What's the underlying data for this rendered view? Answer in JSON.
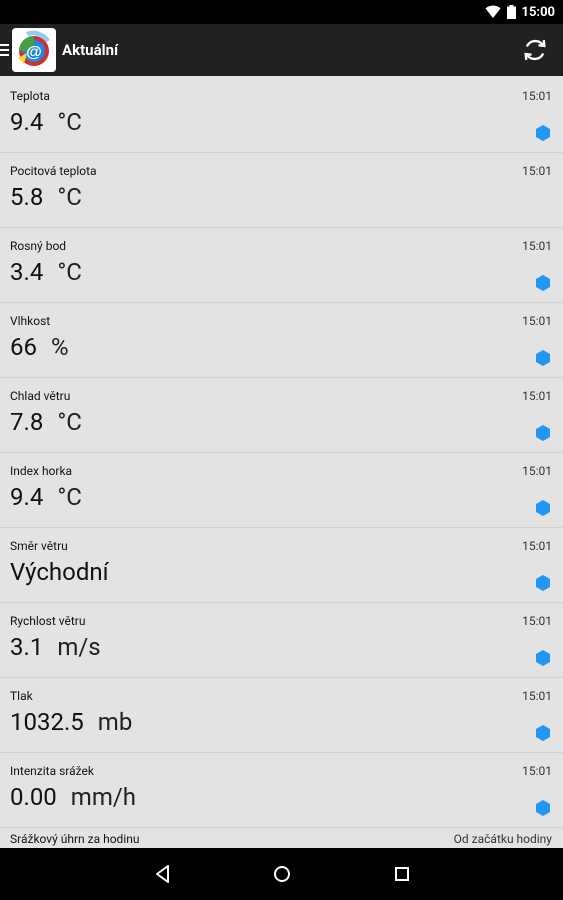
{
  "status_bar": {
    "time": "15:00"
  },
  "app_bar": {
    "title": "Aktuální",
    "app_icon_text": "@"
  },
  "rows": [
    {
      "label": "Teplota",
      "time": "15:01",
      "value": "9.4",
      "unit": "°C",
      "indicator": true
    },
    {
      "label": "Pocitová teplota",
      "time": "15:01",
      "value": "5.8",
      "unit": "°C",
      "indicator": false
    },
    {
      "label": "Rosný bod",
      "time": "15:01",
      "value": "3.4",
      "unit": "°C",
      "indicator": true
    },
    {
      "label": "Vlhkost",
      "time": "15:01",
      "value": "66",
      "unit": "%",
      "indicator": true
    },
    {
      "label": "Chlad větru",
      "time": "15:01",
      "value": "7.8",
      "unit": "°C",
      "indicator": true
    },
    {
      "label": "Index horka",
      "time": "15:01",
      "value": "9.4",
      "unit": "°C",
      "indicator": true
    },
    {
      "label": "Směr větru",
      "time": "15:01",
      "value": "Východní",
      "unit": "",
      "indicator": true
    },
    {
      "label": "Rychlost větru",
      "time": "15:01",
      "value": "3.1",
      "unit": "m/s",
      "indicator": true
    },
    {
      "label": "Tlak",
      "time": "15:01",
      "value": "1032.5",
      "unit": "mb",
      "indicator": true
    },
    {
      "label": "Intenzita srážek",
      "time": "15:01",
      "value": "0.00",
      "unit": "mm/h",
      "indicator": true
    }
  ],
  "partial_row": {
    "label": "Srážkový úhrn za hodinu",
    "time": "Od začátku hodiny"
  },
  "colors": {
    "indicator": "#2196f3",
    "app_bar": "#212121"
  },
  "icons": {
    "status": [
      "wifi-icon",
      "battery-icon"
    ],
    "app_bar": [
      "menu-icon",
      "app-logo-icon",
      "refresh-icon"
    ],
    "nav": [
      "back-icon",
      "home-icon",
      "recents-icon"
    ]
  }
}
